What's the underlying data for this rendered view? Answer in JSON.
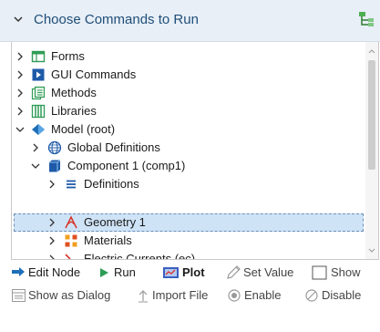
{
  "header": {
    "title": "Choose Commands to Run"
  },
  "tree": [
    {
      "label": "Forms"
    },
    {
      "label": "GUI Commands"
    },
    {
      "label": "Methods"
    },
    {
      "label": "Libraries"
    },
    {
      "label": "Model (root)"
    },
    {
      "label": "Global Definitions"
    },
    {
      "label": "Component 1 (comp1)"
    },
    {
      "label": "Definitions"
    },
    {
      "label": "Geometry 1"
    },
    {
      "label": "Materials"
    },
    {
      "label": "Electric Currents (ec)"
    }
  ],
  "toolbar": {
    "edit_node": "Edit Node",
    "run": "Run",
    "plot": "Plot",
    "set_value": "Set Value",
    "show": "Show",
    "show_as_dialog": "Show as Dialog",
    "import_file": "Import File",
    "enable": "Enable",
    "disable": "Disable"
  },
  "colors": {
    "header_bg": "#e8eff6",
    "title": "#1f4e79",
    "selection": "#cfe3f7"
  }
}
